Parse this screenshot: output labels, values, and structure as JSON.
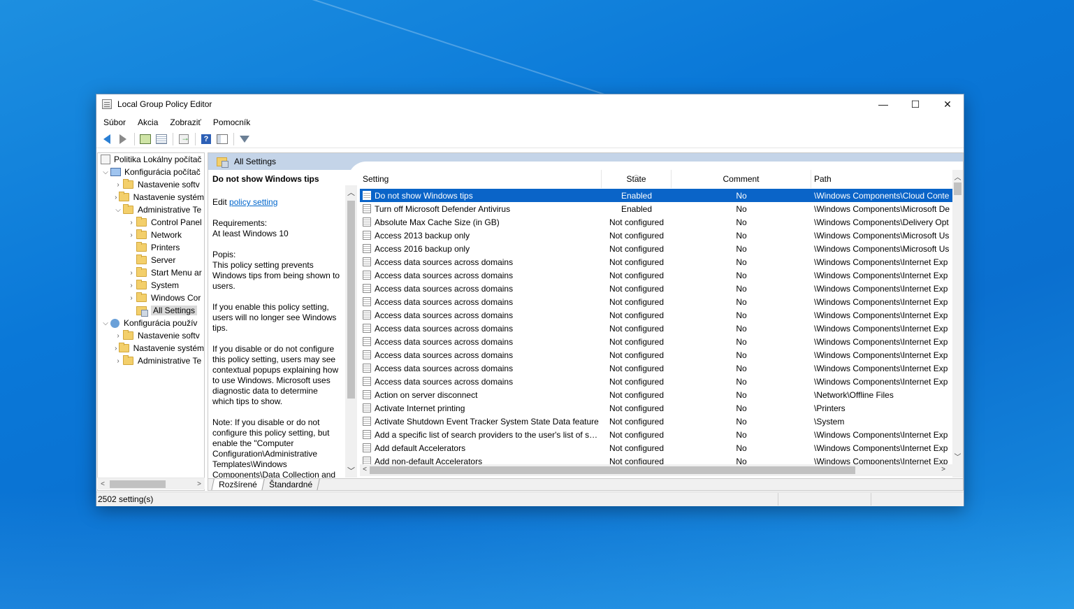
{
  "window": {
    "title": "Local Group Policy Editor",
    "controls": {
      "minimize": "—",
      "maximize": "☐",
      "close": "✕"
    }
  },
  "menu": [
    "Súbor",
    "Akcia",
    "Zobraziť",
    "Pomocník"
  ],
  "toolbar": [
    "back-arrow-icon",
    "forward-arrow-icon",
    "up-folder-icon",
    "show-hide-tree-icon",
    "export-list-icon",
    "help-icon",
    "extended-view-icon",
    "filter-icon"
  ],
  "tree": {
    "root": "Politika Lokálny počítač",
    "computer_config": "Konfigurácia počítač",
    "cc_children": {
      "software": "Nastavenie softv",
      "system": "Nastavenie systém",
      "admin": "Administrative Te"
    },
    "admin_children": [
      "Control Panel",
      "Network",
      "Printers",
      "Server",
      "Start Menu ar",
      "System",
      "Windows Cor"
    ],
    "all_settings": "All Settings",
    "user_config": "Konfigurácia použív",
    "uc_children": [
      "Nastavenie softv",
      "Nastavenie systém",
      "Administrative Te"
    ]
  },
  "header": {
    "title": "All Settings"
  },
  "description": {
    "heading": "Do not show Windows tips",
    "edit_prefix": "Edit",
    "edit_link": "policy setting",
    "requirements_label": "Requirements:",
    "requirements": "At least Windows 10",
    "popis_label": "Popis:",
    "p1": "This policy setting prevents Windows tips from being shown to users.",
    "p2": "If you enable this policy setting, users will no longer see Windows tips.",
    "p3": "If you disable or do not configure this policy setting, users may see contextual popups explaining how to use Windows. Microsoft uses diagnostic data to determine which tips to show.",
    "p4": "Note: If you disable or do not configure this policy setting, but enable the \"Computer Configuration\\Administrative Templates\\Windows Components\\Data Collection and"
  },
  "list": {
    "columns": {
      "setting": "Setting",
      "state": "State",
      "comment": "Comment",
      "path": "Path"
    },
    "rows": [
      {
        "setting": "Do not show Windows tips",
        "state": "Enabled",
        "comment": "No",
        "path": "\\Windows Components\\Cloud Conte"
      },
      {
        "setting": "Turn off Microsoft Defender Antivirus",
        "state": "Enabled",
        "comment": "No",
        "path": "\\Windows Components\\Microsoft De"
      },
      {
        "setting": "Absolute Max Cache Size (in GB)",
        "state": "Not configured",
        "comment": "No",
        "path": "\\Windows Components\\Delivery Opt"
      },
      {
        "setting": "Access 2013 backup only",
        "state": "Not configured",
        "comment": "No",
        "path": "\\Windows Components\\Microsoft Us"
      },
      {
        "setting": "Access 2016 backup only",
        "state": "Not configured",
        "comment": "No",
        "path": "\\Windows Components\\Microsoft Us"
      },
      {
        "setting": "Access data sources across domains",
        "state": "Not configured",
        "comment": "No",
        "path": "\\Windows Components\\Internet Exp"
      },
      {
        "setting": "Access data sources across domains",
        "state": "Not configured",
        "comment": "No",
        "path": "\\Windows Components\\Internet Exp"
      },
      {
        "setting": "Access data sources across domains",
        "state": "Not configured",
        "comment": "No",
        "path": "\\Windows Components\\Internet Exp"
      },
      {
        "setting": "Access data sources across domains",
        "state": "Not configured",
        "comment": "No",
        "path": "\\Windows Components\\Internet Exp"
      },
      {
        "setting": "Access data sources across domains",
        "state": "Not configured",
        "comment": "No",
        "path": "\\Windows Components\\Internet Exp"
      },
      {
        "setting": "Access data sources across domains",
        "state": "Not configured",
        "comment": "No",
        "path": "\\Windows Components\\Internet Exp"
      },
      {
        "setting": "Access data sources across domains",
        "state": "Not configured",
        "comment": "No",
        "path": "\\Windows Components\\Internet Exp"
      },
      {
        "setting": "Access data sources across domains",
        "state": "Not configured",
        "comment": "No",
        "path": "\\Windows Components\\Internet Exp"
      },
      {
        "setting": "Access data sources across domains",
        "state": "Not configured",
        "comment": "No",
        "path": "\\Windows Components\\Internet Exp"
      },
      {
        "setting": "Access data sources across domains",
        "state": "Not configured",
        "comment": "No",
        "path": "\\Windows Components\\Internet Exp"
      },
      {
        "setting": "Action on server disconnect",
        "state": "Not configured",
        "comment": "No",
        "path": "\\Network\\Offline Files"
      },
      {
        "setting": "Activate Internet printing",
        "state": "Not configured",
        "comment": "No",
        "path": "\\Printers"
      },
      {
        "setting": "Activate Shutdown Event Tracker System State Data feature",
        "state": "Not configured",
        "comment": "No",
        "path": "\\System"
      },
      {
        "setting": "Add a specific list of search providers to the user's list of sea...",
        "state": "Not configured",
        "comment": "No",
        "path": "\\Windows Components\\Internet Exp"
      },
      {
        "setting": "Add default Accelerators",
        "state": "Not configured",
        "comment": "No",
        "path": "\\Windows Components\\Internet Exp"
      },
      {
        "setting": "Add non-default Accelerators",
        "state": "Not configured",
        "comment": "No",
        "path": "\\Windows Components\\Internet Exp"
      }
    ]
  },
  "tabs": {
    "extended": "Rozšírené",
    "standard": "Štandardné"
  },
  "status": {
    "text": "2502 setting(s)"
  }
}
